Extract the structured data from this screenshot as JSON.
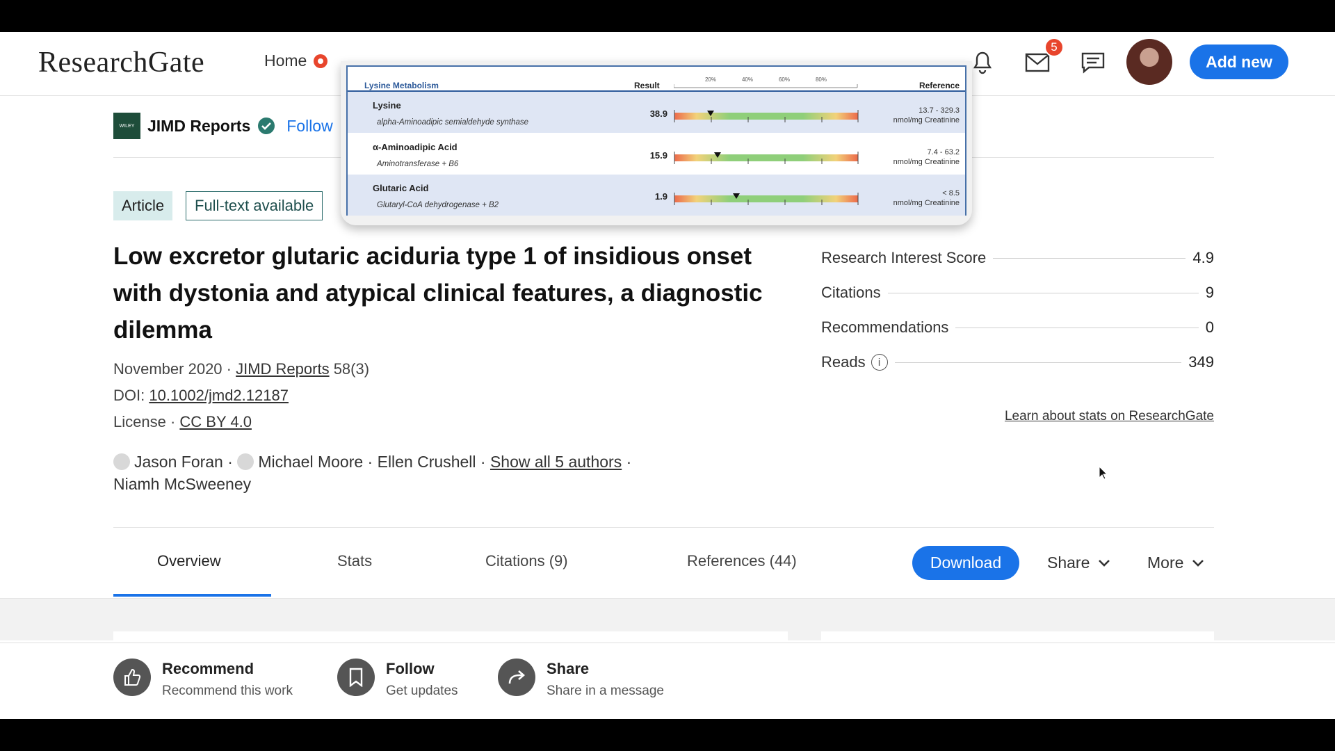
{
  "header": {
    "logo": "ResearchGate",
    "home": "Home",
    "messages_badge": "5",
    "add_new": "Add new"
  },
  "journal": {
    "logo_text": "WILEY",
    "name": "JIMD Reports",
    "follow": "Follow"
  },
  "tags": {
    "article": "Article",
    "full_text": "Full-text available"
  },
  "title": "Low excretor glutaric aciduria type 1 of insidious onset with dystonia and atypical clinical features, a diagnostic dilemma",
  "meta": {
    "date": "November 2020 · ",
    "journal_link": "JIMD Reports",
    "issue": " 58(3)",
    "doi_label": "DOI: ",
    "doi": "10.1002/jmd2.12187",
    "license_label": "License · ",
    "license": "CC BY 4.0"
  },
  "authors": {
    "a1": "Jason Foran",
    "a2": "Michael Moore",
    "a3": "Ellen Crushell",
    "show_all": "Show all 5 authors",
    "a5": "Niamh McSweeney",
    "sep": " · "
  },
  "stats": {
    "research_interest_label": "Research Interest Score",
    "research_interest_value": "4.9",
    "citations_label": "Citations",
    "citations_value": "9",
    "recommendations_label": "Recommendations",
    "recommendations_value": "0",
    "reads_label": "Reads",
    "reads_value": "349",
    "learn": "Learn about stats on ResearchGate"
  },
  "tabs": {
    "overview": "Overview",
    "stats": "Stats",
    "citations": "Citations (9)",
    "references": "References (44)",
    "download": "Download",
    "share": "Share",
    "more": "More"
  },
  "actions": {
    "recommend_title": "Recommend",
    "recommend_sub": "Recommend this work",
    "follow_title": "Follow",
    "follow_sub": "Get updates",
    "share_title": "Share",
    "share_sub": "Share in a message"
  },
  "popup": {
    "section": "Lysine Metabolism",
    "result_header": "Result",
    "reference_header": "Reference",
    "scale": [
      "20%",
      "40%",
      "60%",
      "80%"
    ],
    "rows": [
      {
        "name": "Lysine",
        "enzyme": "alpha-Aminoadipic semialdehyde synthase",
        "result": "38.9",
        "ref_range": "13.7 - 329.3",
        "ref_unit": "nmol/mg Creatinine",
        "marker": 0.2
      },
      {
        "name": "α-Aminoadipic Acid",
        "enzyme": "Aminotransferase + B6",
        "result": "15.9",
        "ref_range": "7.4 - 63.2",
        "ref_unit": "nmol/mg Creatinine",
        "marker": 0.24
      },
      {
        "name": "Glutaric Acid",
        "enzyme": "Glutaryl-CoA dehydrogenase + B2",
        "result": "1.9",
        "ref_range": "< 8.5",
        "ref_unit": "nmol/mg Creatinine",
        "marker": 0.34
      }
    ]
  }
}
